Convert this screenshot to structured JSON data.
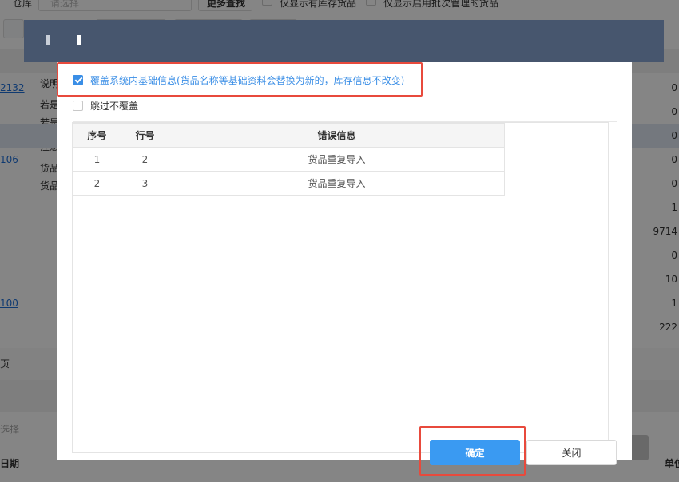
{
  "background": {
    "warehouse_label": "仓库",
    "warehouse_placeholder": "请选择",
    "more_search": "更多查找",
    "only_stock": "仅显示有库存货品",
    "only_batch": "仅显示启用批次管理的货品",
    "left_labels": [
      "说明",
      "若是",
      "若是",
      "注意",
      "货品",
      "货品"
    ],
    "left_links": [
      "2132",
      "106",
      "100"
    ],
    "right_values": [
      "0",
      "0",
      "0",
      "0",
      "0",
      "1",
      "9714",
      "0",
      "10",
      "1",
      "222"
    ],
    "footer_page": "页",
    "footer_select": "选择",
    "footer_date": "日期",
    "footer_unit": "单位"
  },
  "dialog": {
    "overwrite_option": "覆盖系统内基础信息(货品名称等基础资料会替换为新的，库存信息不改变)",
    "overwrite_checked": true,
    "skip_option": "跳过不覆盖",
    "skip_checked": false,
    "table": {
      "headers": [
        "序号",
        "行号",
        "错误信息"
      ],
      "rows": [
        [
          "1",
          "2",
          "货品重复导入"
        ],
        [
          "2",
          "3",
          "货品重复导入"
        ]
      ]
    },
    "confirm_label": "确定",
    "close_label": "关闭"
  },
  "colors": {
    "header_bg": "#47566e",
    "accent": "#3a9af2",
    "highlight": "#e84a3c"
  }
}
